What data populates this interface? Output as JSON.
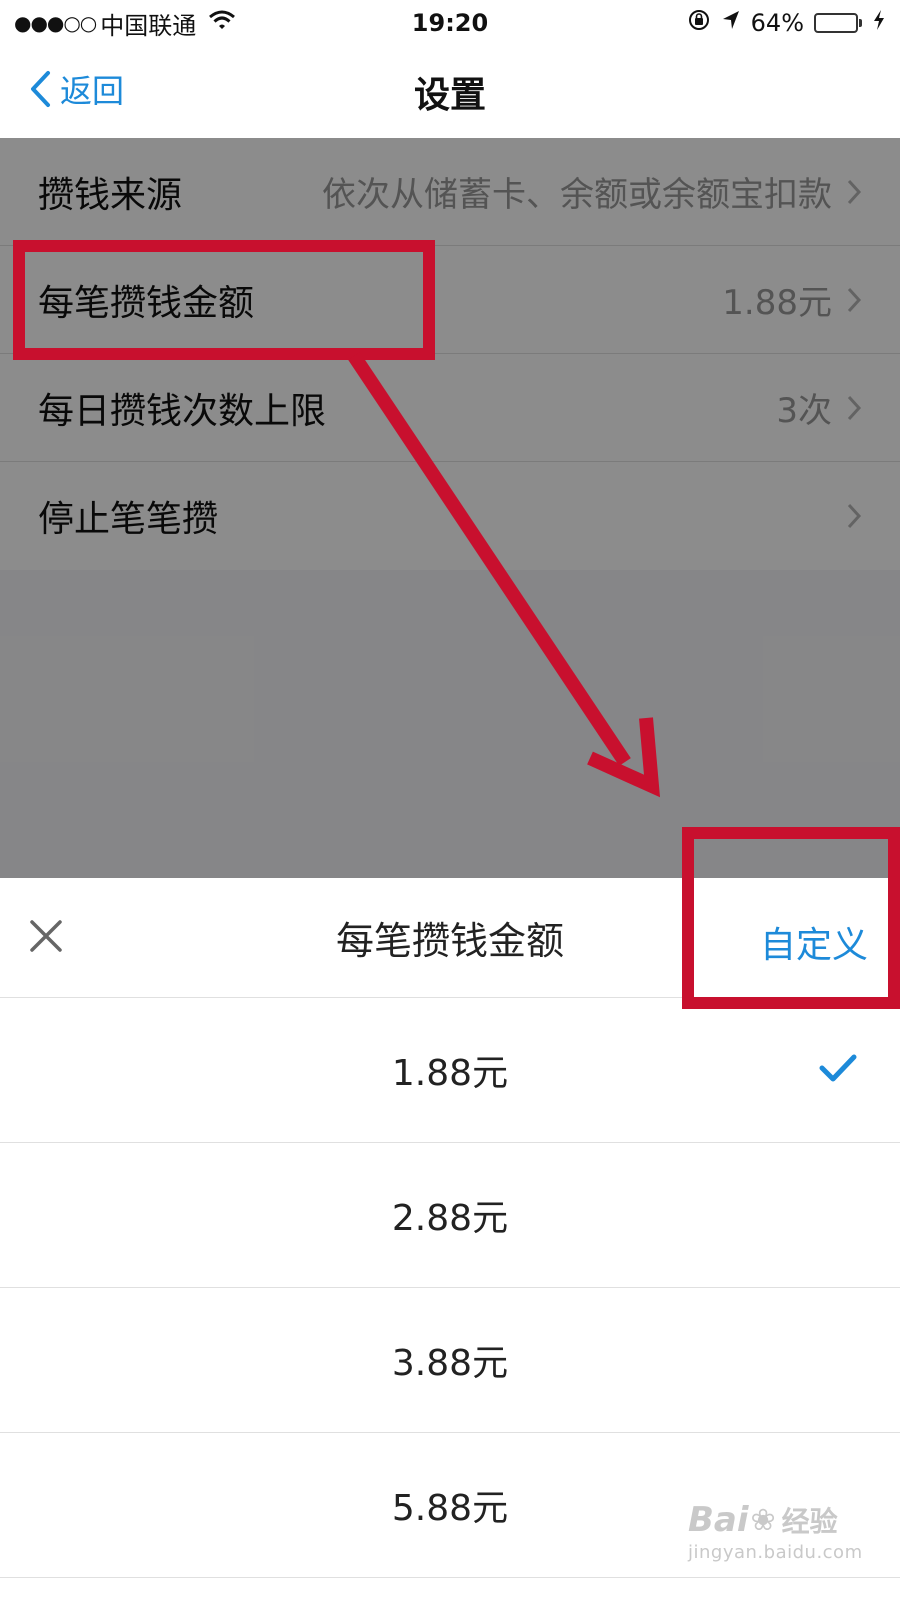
{
  "status_bar": {
    "signal": "●●●○○",
    "carrier": "中国联通",
    "time": "19:20",
    "battery_pct": "64%",
    "battery_level": 0.64,
    "battery_color": "#4cd964"
  },
  "nav": {
    "back_label": "返回",
    "title": "设置",
    "accent": "#1d8ad9"
  },
  "settings": [
    {
      "label": "攒钱来源",
      "value": "依次从储蓄卡、余额或余额宝扣款"
    },
    {
      "label": "每笔攒钱金额",
      "value": "1.88元"
    },
    {
      "label": "每日攒钱次数上限",
      "value": "3次"
    },
    {
      "label": "停止笔笔攒",
      "value": ""
    }
  ],
  "sheet": {
    "title": "每笔攒钱金额",
    "custom_label": "自定义",
    "options": [
      {
        "label": "1.88元",
        "selected": true
      },
      {
        "label": "2.88元",
        "selected": false
      },
      {
        "label": "3.88元",
        "selected": false
      },
      {
        "label": "5.88元",
        "selected": false
      }
    ]
  },
  "annotation_color": "#c8102e",
  "watermark": {
    "logo_left": "Bai",
    "logo_right": "经验",
    "url": "jingyan.baidu.com"
  }
}
